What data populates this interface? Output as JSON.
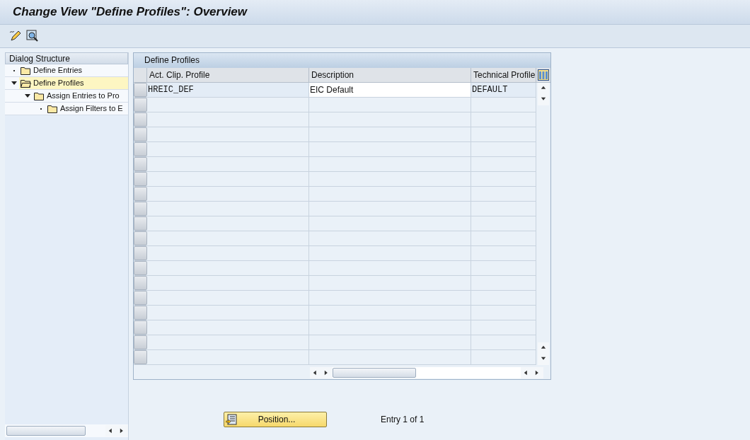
{
  "window": {
    "title": "Change View \"Define Profiles\": Overview"
  },
  "dialog_structure": {
    "title": "Dialog Structure",
    "items": [
      {
        "label": "Define Entries",
        "selected": false
      },
      {
        "label": "Define Profiles",
        "selected": true,
        "expanded": true,
        "children": [
          {
            "label": "Assign Entries to Pro",
            "selected": false,
            "expanded": true,
            "children": [
              {
                "label": "Assign Filters to E",
                "selected": false
              }
            ]
          }
        ]
      }
    ]
  },
  "table": {
    "title": "Define Profiles",
    "columns": [
      "Act. Clip. Profile",
      "Description",
      "Technical Profile"
    ],
    "rows": [
      {
        "cells": [
          "HREIC_DEF",
          "EIC Default",
          "DEFAULT"
        ]
      }
    ]
  },
  "position_button": "Position...",
  "entry_count": "Entry 1 of 1"
}
